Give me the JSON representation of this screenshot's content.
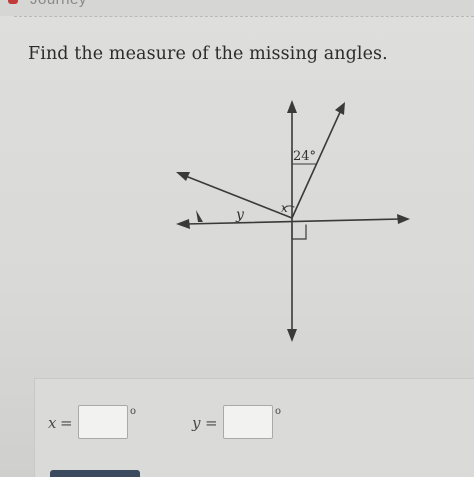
{
  "header": {
    "brand_text": "Journey"
  },
  "question": {
    "prompt": "Find the measure of the missing angles."
  },
  "figure": {
    "angle_label": "24°",
    "x_label": "x",
    "y_label": "y"
  },
  "answers": {
    "x_label": "x",
    "y_label": "y",
    "equals": "=",
    "degree_symbol": "o"
  },
  "colors": {
    "ink": "#3a3a3a",
    "background": "#d9d9d7"
  },
  "icons": {
    "right_angle": "right-angle-marker",
    "arrowheads": "arrow-icon"
  }
}
